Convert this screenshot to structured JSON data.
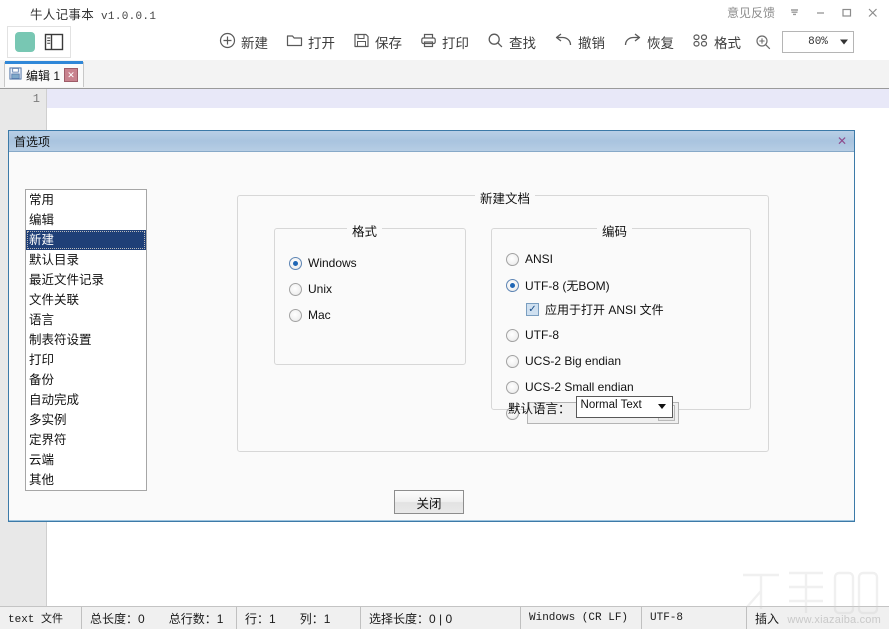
{
  "window": {
    "title": "牛人记事本",
    "version": "v1.0.0.1",
    "feedback": "意见反馈",
    "minimize": "−",
    "maximize": "□",
    "close": "✕"
  },
  "toolbar": {
    "items": [
      {
        "icon": "plus-circle-icon",
        "label": "新建"
      },
      {
        "icon": "folder-open-icon",
        "label": "打开"
      },
      {
        "icon": "save-disk-icon",
        "label": "保存"
      },
      {
        "icon": "printer-icon",
        "label": "打印"
      },
      {
        "icon": "magnifier-icon",
        "label": "查找"
      },
      {
        "icon": "undo-arrow-icon",
        "label": "撤销"
      },
      {
        "icon": "redo-arrow-icon",
        "label": "恢复"
      },
      {
        "icon": "grid-squares-icon",
        "label": "格式"
      }
    ],
    "zoom_icon": "zoom-in-icon",
    "zoom_value": "80%",
    "color_swatch": "#78c7b3"
  },
  "tab": {
    "icon": "save-disk-icon",
    "label": "编辑 1",
    "close": "✕"
  },
  "editor": {
    "line_number": "1",
    "content": ""
  },
  "statusbar": {
    "filetype": "text 文件",
    "total_length": "总长度：0",
    "total_lines": "总行数：1",
    "line": "行：1",
    "column": "列：1",
    "selection": "选择长度：0 | 0",
    "eol": "Windows (CR LF)",
    "encoding": "UTF-8",
    "insert_mode": "插入",
    "watermark": "www.xiazaiba.com"
  },
  "dialog": {
    "title": "首选项",
    "close_icon": "✕",
    "categories": [
      "常用",
      "编辑",
      "新建",
      "默认目录",
      "最近文件记录",
      "文件关联",
      "语言",
      "制表符设置",
      "打印",
      "备份",
      "自动完成",
      "多实例",
      "定界符",
      "云端",
      "其他"
    ],
    "selected_category_index": 2,
    "newdoc_group": "新建文档",
    "format_group": "格式",
    "format_options": [
      {
        "label": "Windows",
        "selected": true
      },
      {
        "label": "Unix",
        "selected": false
      },
      {
        "label": "Mac",
        "selected": false
      }
    ],
    "encoding_group": "编码",
    "encoding_options": [
      {
        "label": "ANSI",
        "selected": false
      },
      {
        "label": "UTF-8 (无BOM)",
        "selected": true
      },
      {
        "label": "UTF-8",
        "selected": false
      },
      {
        "label": "UCS-2 Big endian",
        "selected": false
      },
      {
        "label": "UCS-2 Small endian",
        "selected": false
      }
    ],
    "apply_ansi_checkbox": {
      "label": "应用于打开 ANSI 文件",
      "checked": true,
      "mark": "✓"
    },
    "custom_encoding": {
      "value": "",
      "placeholder": ""
    },
    "language_label": "默认语言：",
    "language_value": "Normal Text",
    "close_button": "关闭"
  }
}
